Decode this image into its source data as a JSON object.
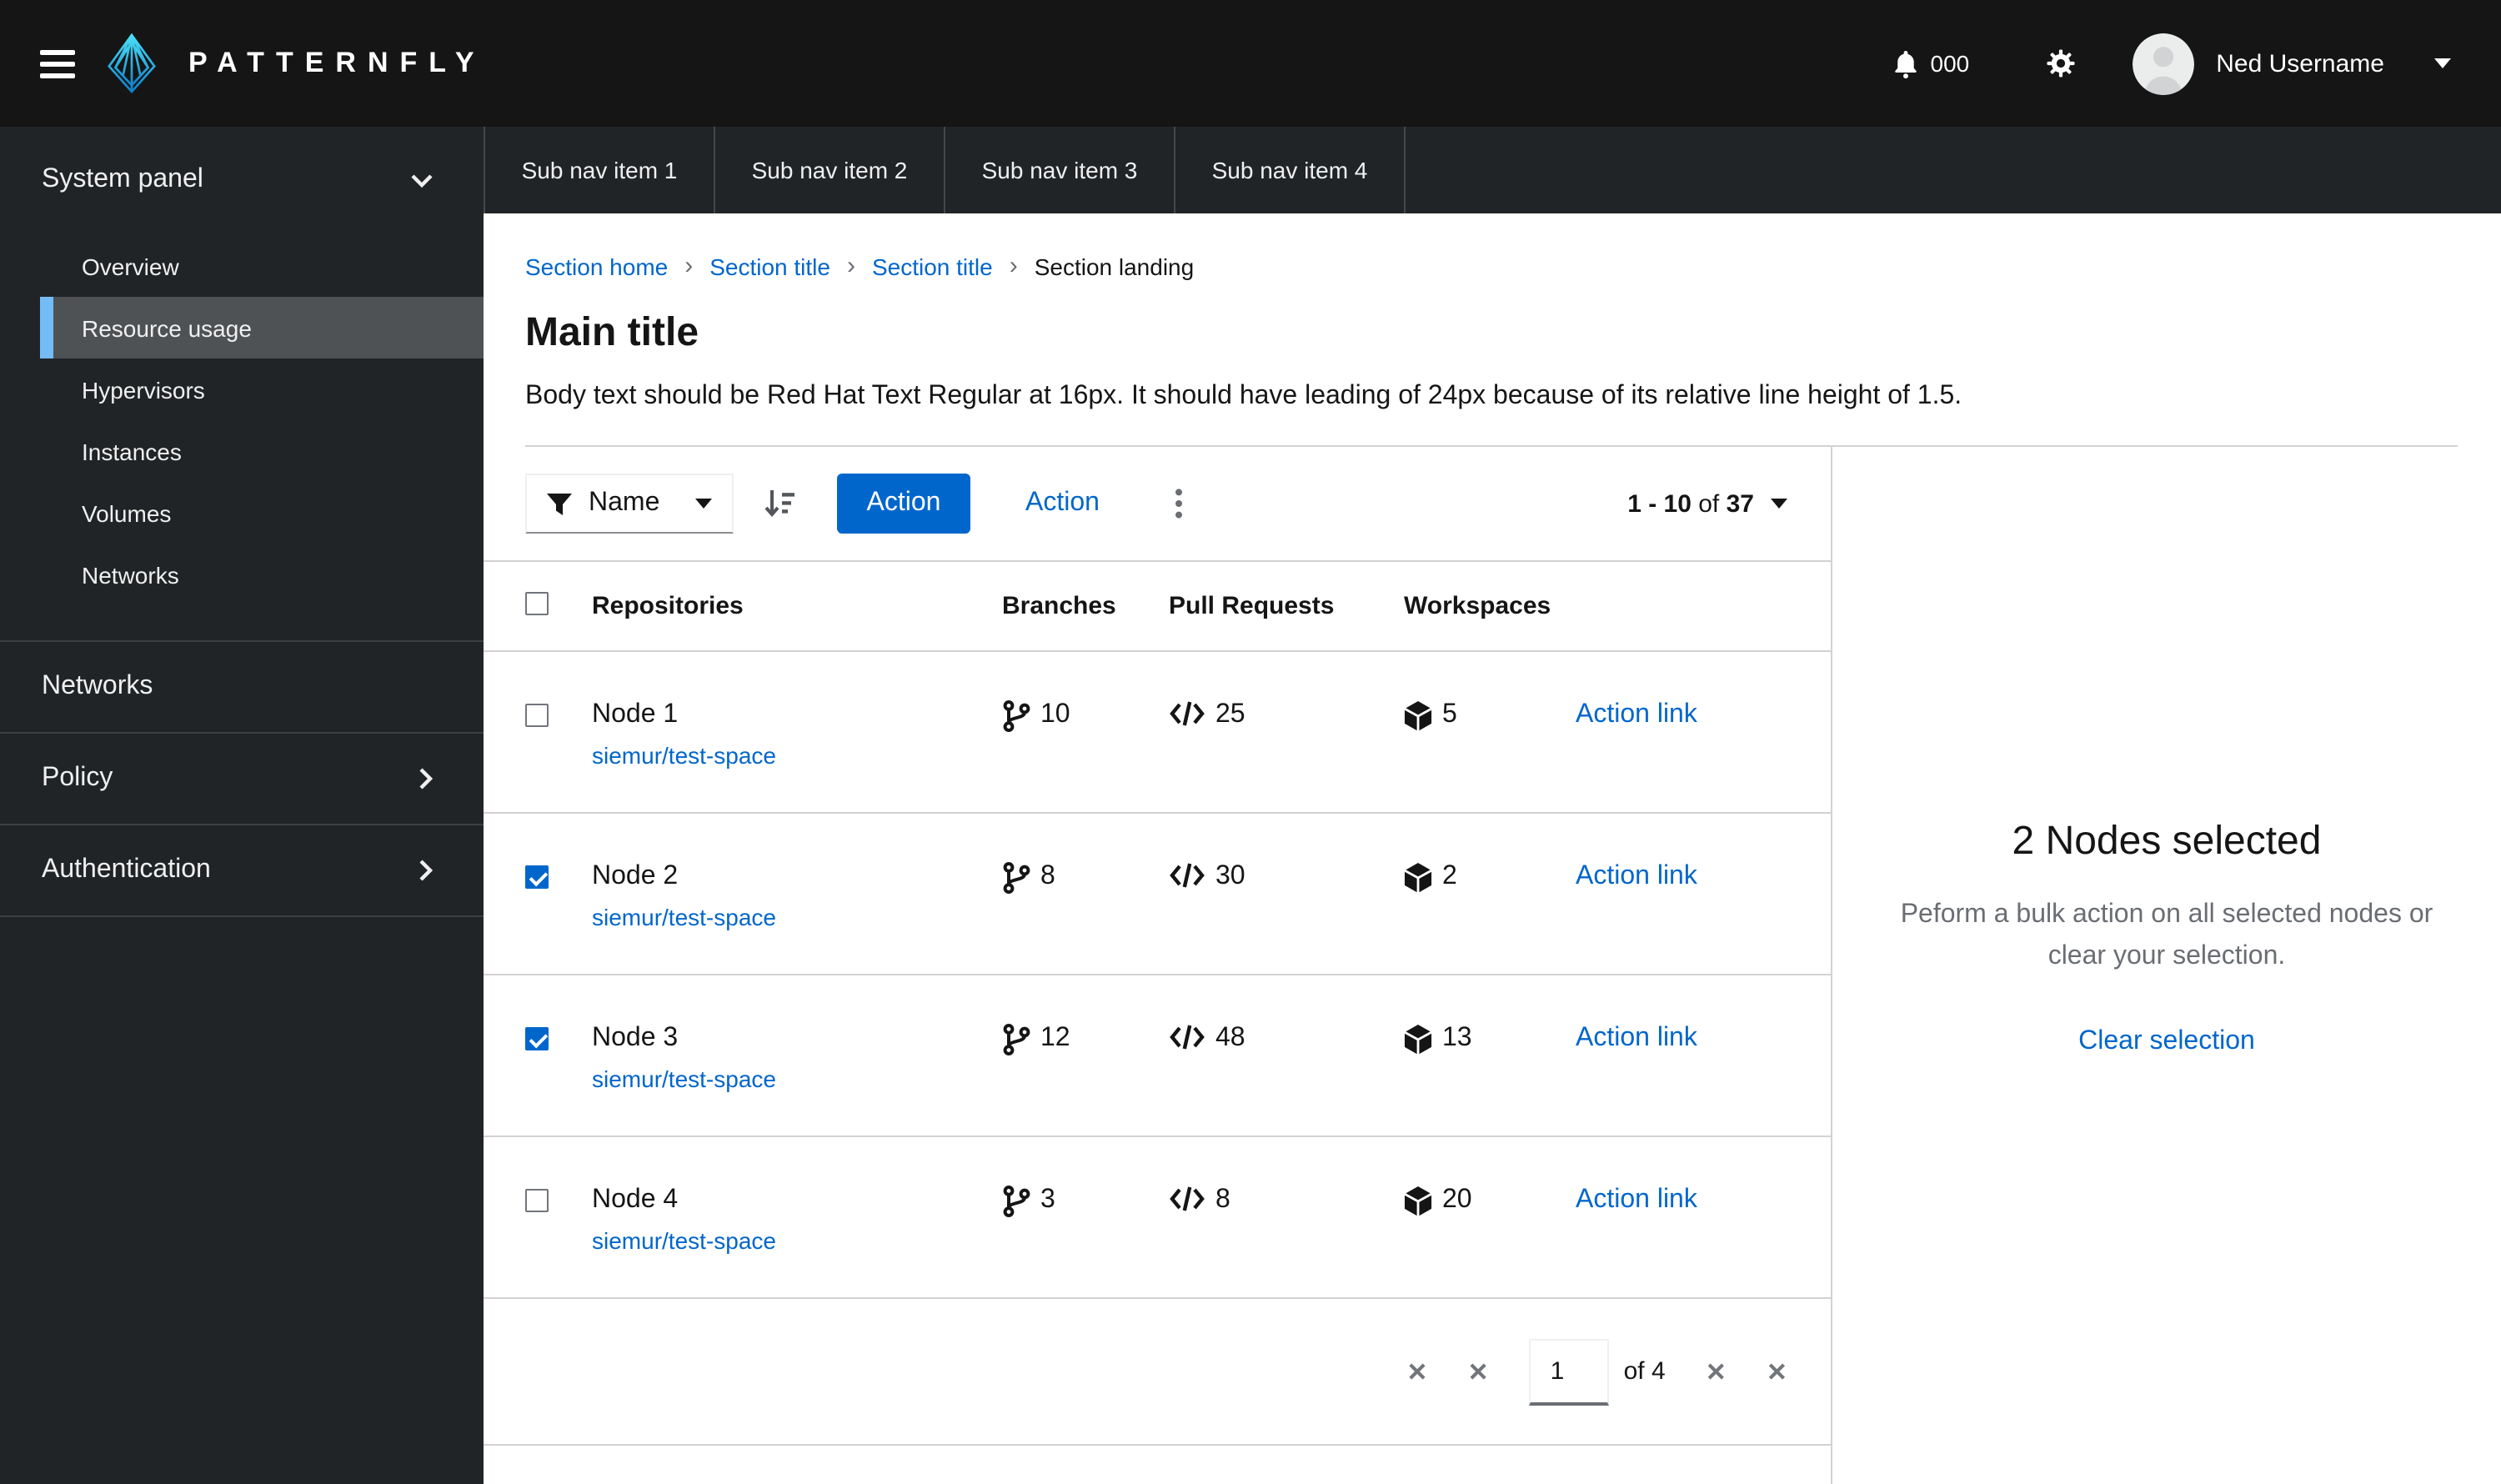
{
  "masthead": {
    "logo_text": "PATTERNFLY",
    "notification_count": "000",
    "username": "Ned Username"
  },
  "sidebar": {
    "group": {
      "label": "System panel",
      "items": [
        {
          "label": "Overview",
          "selected": false
        },
        {
          "label": "Resource usage",
          "selected": true
        },
        {
          "label": "Hypervisors",
          "selected": false
        },
        {
          "label": "Instances",
          "selected": false
        },
        {
          "label": "Volumes",
          "selected": false
        },
        {
          "label": "Networks",
          "selected": false
        }
      ]
    },
    "sections": [
      {
        "label": "Networks",
        "expandable": false
      },
      {
        "label": "Policy",
        "expandable": true
      },
      {
        "label": "Authentication",
        "expandable": true
      }
    ]
  },
  "subnav": {
    "tabs": [
      {
        "label": "Sub nav item 1"
      },
      {
        "label": "Sub nav item 2"
      },
      {
        "label": "Sub nav item 3"
      },
      {
        "label": "Sub nav item 4"
      }
    ]
  },
  "breadcrumb": {
    "items": [
      {
        "label": "Section home"
      },
      {
        "label": "Section title"
      },
      {
        "label": "Section title"
      }
    ],
    "current": "Section landing"
  },
  "page": {
    "title": "Main title",
    "body": "Body text should be Red Hat Text Regular at 16px. It should have leading of 24px because of its relative line height of 1.5."
  },
  "toolbar": {
    "filter_label": "Name",
    "primary_action_label": "Action",
    "secondary_action_label": "Action",
    "pagination": {
      "range": "1 - 10",
      "of": "of",
      "total": "37"
    }
  },
  "table": {
    "headers": [
      "Repositories",
      "Branches",
      "Pull Requests",
      "Workspaces"
    ],
    "rows": [
      {
        "name": "Node 1",
        "repo": "siemur/test-space",
        "branches": "10",
        "pull_requests": "25",
        "workspaces": "5",
        "action": "Action link",
        "selected": false
      },
      {
        "name": "Node 2",
        "repo": "siemur/test-space",
        "branches": "8",
        "pull_requests": "30",
        "workspaces": "2",
        "action": "Action link",
        "selected": true
      },
      {
        "name": "Node 3",
        "repo": "siemur/test-space",
        "branches": "12",
        "pull_requests": "48",
        "workspaces": "13",
        "action": "Action link",
        "selected": true
      },
      {
        "name": "Node 4",
        "repo": "siemur/test-space",
        "branches": "3",
        "pull_requests": "8",
        "workspaces": "20",
        "action": "Action link",
        "selected": false
      }
    ]
  },
  "footer_pagination": {
    "current_page": "1",
    "of_label": "of 4",
    "broken_icon_glyph": "✕"
  },
  "drawer": {
    "title": "2 Nodes selected",
    "body": "Peform a bulk action on all selected nodes or clear your selection.",
    "link_label": "Clear selection"
  },
  "colors": {
    "accent": "#0066cc",
    "masthead_bg": "#151515",
    "panel_bg": "#212427",
    "nav_selected_bg": "#4f5255",
    "nav_indicator": "#73bcf7",
    "text_primary": "#151515",
    "text_muted": "#6a6e73",
    "border_light": "#d2d2d2"
  }
}
